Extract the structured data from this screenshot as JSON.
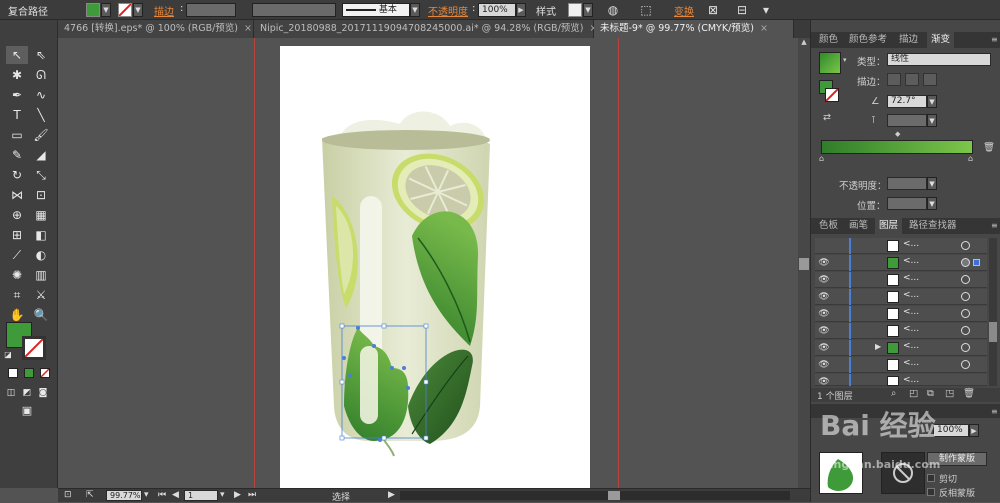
{
  "control_bar": {
    "object_type": "复合路径",
    "stroke_label": "描边",
    "stroke_profile": "基本",
    "opacity_label": "不透明度",
    "opacity_value": "100%",
    "style_label": "样式",
    "transform_label": "变换"
  },
  "tabs": [
    {
      "label": "4766 [转换].eps* @ 100% (RGB/预览)",
      "active": false
    },
    {
      "label": "Nipic_20180988_20171119094708245000.ai* @ 94.28% (RGB/预览)",
      "active": false
    },
    {
      "label": "未标题-9* @ 99.77% (CMYK/预览)",
      "active": true
    }
  ],
  "status_bar": {
    "zoom": "99.77%",
    "page": "1",
    "tool_label": "选择"
  },
  "gradient_panel": {
    "tabs": [
      "颜色",
      "颜色参考",
      "描边",
      "渐变"
    ],
    "active_tab": "渐变",
    "type_label": "类型：",
    "type_value": "线性",
    "stroke_label": "描边：",
    "angle_value": "72.7°",
    "opacity_label": "不透明度：",
    "position_label": "位置："
  },
  "layers_panel": {
    "tabs": [
      "色板",
      "画笔",
      "图层",
      "路径查找器"
    ],
    "active_tab": "图层",
    "layer_count": "1 个图层",
    "rows": [
      {
        "name": "<..."
      },
      {
        "name": "<..."
      },
      {
        "name": "<..."
      },
      {
        "name": "<..."
      },
      {
        "name": "<..."
      },
      {
        "name": "<..."
      },
      {
        "name": "<..."
      },
      {
        "name": "<..."
      },
      {
        "name": "<..."
      }
    ]
  },
  "transparency_panel": {
    "opacity_value": "100%",
    "make_mask_label": "制作蒙版",
    "clip_label": "剪切",
    "invert_mask_label": "反相蒙版"
  },
  "colors": {
    "green_accent": "#3f9a3a",
    "orange_label": "#e6863a",
    "bleed_line": "#b8443e",
    "layer_bar": "#4a7fd6"
  },
  "watermark": {
    "main": "Bai 经验",
    "sub": "jingyan.baidu.com"
  }
}
